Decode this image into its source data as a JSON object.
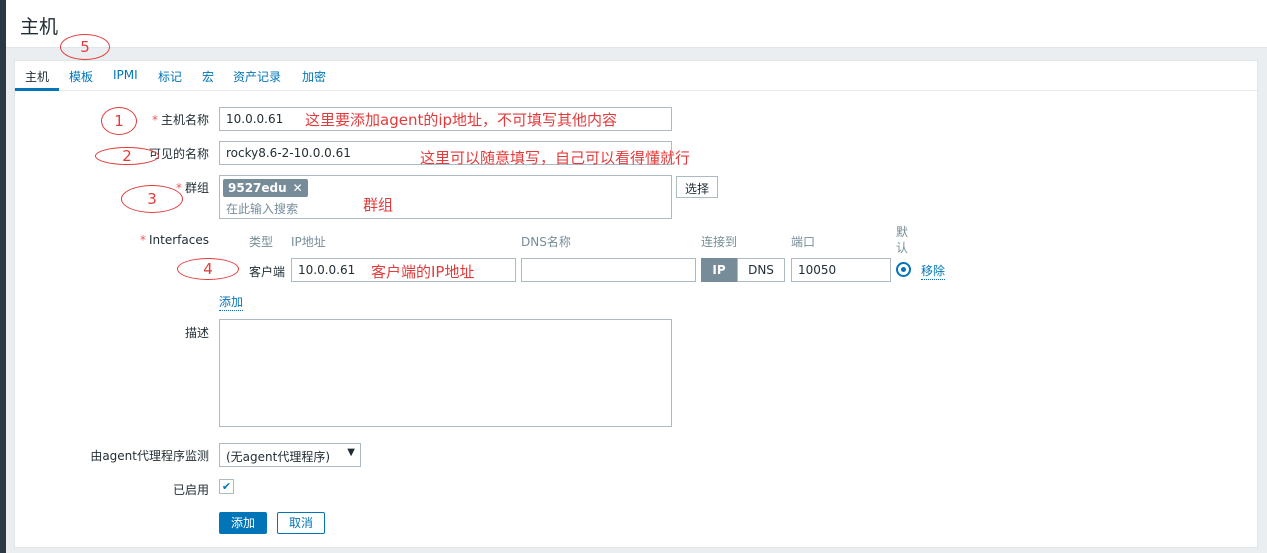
{
  "page_title": "主机",
  "tabs": [
    {
      "label": "主机"
    },
    {
      "label": "模板"
    },
    {
      "label": "IPMI"
    },
    {
      "label": "标记"
    },
    {
      "label": "宏"
    },
    {
      "label": "资产记录"
    },
    {
      "label": "加密"
    }
  ],
  "form": {
    "host_name_label": "主机名称",
    "host_name_value": "10.0.0.61",
    "visible_name_label": "可见的名称",
    "visible_name_value": "rocky8.6-2-10.0.0.61",
    "groups_label": "群组",
    "group_tag": "9527edu",
    "groups_placeholder": "在此输入搜索",
    "select_button": "选择",
    "interfaces_label": "Interfaces",
    "interfaces_headers": {
      "type": "类型",
      "ip": "IP地址",
      "dns": "DNS名称",
      "connect": "连接到",
      "port": "端口",
      "default": "默认"
    },
    "interface_row": {
      "type": "客户端",
      "ip": "10.0.0.61",
      "dns": "",
      "connect_ip": "IP",
      "connect_dns": "DNS",
      "port": "10050",
      "remove": "移除"
    },
    "add_interface": "添加",
    "description_label": "描述",
    "description_value": "",
    "proxy_label": "由agent代理程序监测",
    "proxy_value": "(无agent代理程序)",
    "enabled_label": "已启用",
    "enabled_checked": true,
    "add_button": "添加",
    "cancel_button": "取消"
  },
  "annotations": {
    "num1": "1",
    "num2": "2",
    "num3": "3",
    "num4": "4",
    "num5": "5",
    "note_host_name": "这里要添加agent的ip地址，不可填写其他内容",
    "note_visible_name": "这里可以随意填写，自己可以看得懂就行",
    "note_groups": "群组",
    "note_ip": "客户端的IP地址"
  },
  "colors": {
    "accent": "#0275b8",
    "annotation": "#e33b3b",
    "tag": "#768d99"
  }
}
